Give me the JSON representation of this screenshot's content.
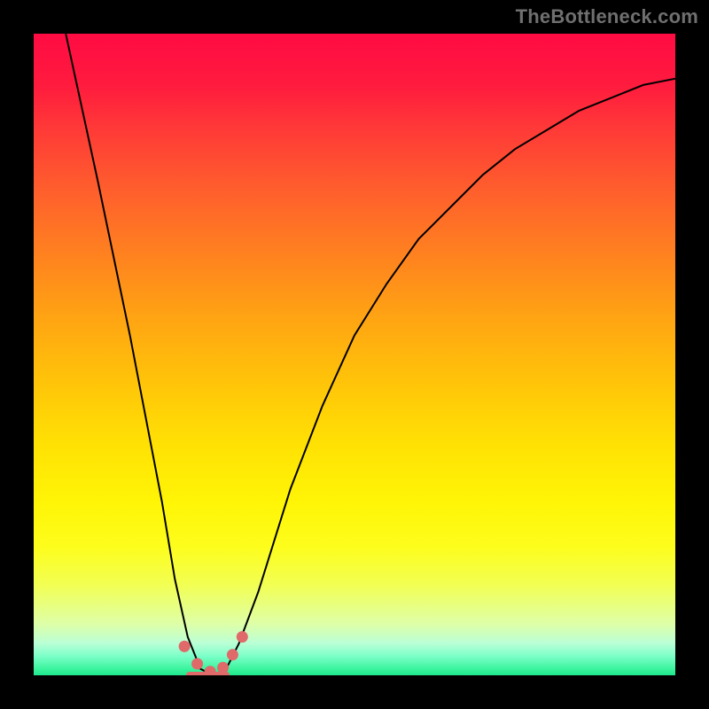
{
  "watermark": "TheBottleneck.com",
  "chart_data": {
    "type": "line",
    "title": "",
    "xlabel": "",
    "ylabel": "",
    "xlim": [
      0,
      1
    ],
    "ylim": [
      0,
      1
    ],
    "background": "rainbow-vertical",
    "series": [
      {
        "name": "curve",
        "x": [
          0.05,
          0.1,
          0.15,
          0.2,
          0.22,
          0.24,
          0.26,
          0.28,
          0.3,
          0.32,
          0.35,
          0.4,
          0.45,
          0.5,
          0.55,
          0.6,
          0.65,
          0.7,
          0.75,
          0.8,
          0.85,
          0.9,
          0.95,
          1.0
        ],
        "y": [
          1.0,
          0.77,
          0.53,
          0.27,
          0.15,
          0.06,
          0.01,
          0.0,
          0.01,
          0.05,
          0.13,
          0.29,
          0.42,
          0.53,
          0.61,
          0.68,
          0.73,
          0.78,
          0.82,
          0.85,
          0.88,
          0.9,
          0.92,
          0.93
        ]
      }
    ],
    "markers": {
      "name": "bottom-points",
      "color": "#e06a6a",
      "points": [
        {
          "x": 0.235,
          "y": 0.045
        },
        {
          "x": 0.255,
          "y": 0.018
        },
        {
          "x": 0.275,
          "y": 0.006
        },
        {
          "x": 0.295,
          "y": 0.012
        },
        {
          "x": 0.31,
          "y": 0.032
        },
        {
          "x": 0.325,
          "y": 0.06
        }
      ],
      "cap": {
        "x1": 0.243,
        "x2": 0.3,
        "y": 0.0
      }
    },
    "gradient_stops": [
      {
        "pos": 0.0,
        "color": "#ff0b43"
      },
      {
        "pos": 0.5,
        "color": "#ffcf07"
      },
      {
        "pos": 0.8,
        "color": "#fdfd1c"
      },
      {
        "pos": 1.0,
        "color": "#1ee78d"
      }
    ]
  }
}
